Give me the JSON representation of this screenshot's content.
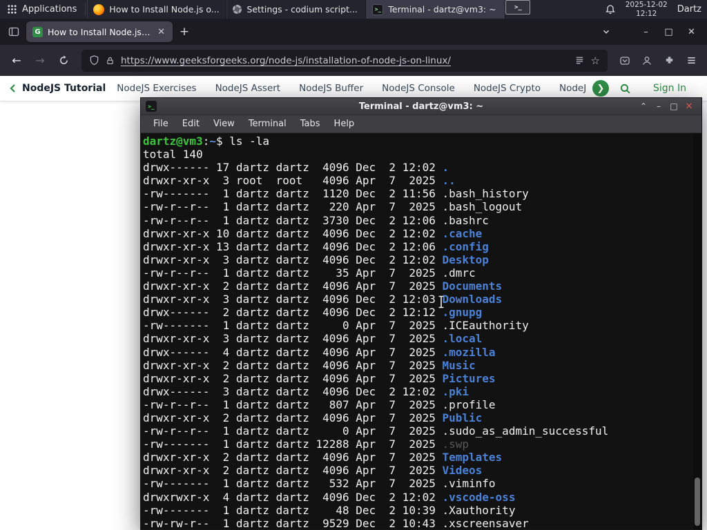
{
  "colors": {
    "gfg_green": "#2f8d46",
    "terminal_dir_blue": "#4b82d8",
    "terminal_prompt_green": "#3cc53c",
    "terminal_dim_gray": "#585858",
    "terminal_bg": "#121212",
    "browser_dark": "#2b2a33"
  },
  "taskbar": {
    "applications_label": "Applications",
    "windows": [
      {
        "icon": "firefox",
        "title": "How to Install Node.js o..."
      },
      {
        "icon": "settings",
        "title": "Settings - codium script..."
      },
      {
        "icon": "terminal",
        "title": "Terminal - dartz@vm3: ~"
      }
    ],
    "clock": {
      "date": "2025-12-02",
      "time": "12:12"
    },
    "user": "Dartz"
  },
  "browser": {
    "tab_title": "How to Install Node.js on...",
    "url": "https://www.geeksforgeeks.org/node-js/installation-of-node-js-on-linux/"
  },
  "gfg_nav": {
    "active_item": "NodeJS Tutorial",
    "items": [
      "NodeJS Exercises",
      "NodeJS Assert",
      "NodeJS Buffer",
      "NodeJS Console",
      "NodeJS Crypto",
      "NodeJS DNS",
      "Node"
    ],
    "sign_in_label": "Sign In"
  },
  "terminal": {
    "window_title": "Terminal - dartz@vm3: ~",
    "menu_items": [
      "File",
      "Edit",
      "View",
      "Terminal",
      "Tabs",
      "Help"
    ],
    "prompt_user": "dartz@vm3",
    "prompt_path": "~",
    "command": "ls -la",
    "total_line": "total 140",
    "listing": [
      {
        "perms": "drwx------",
        "links": "17",
        "owner": "dartz",
        "group": "dartz",
        "size": "4096",
        "month": "Dec",
        "day": "2",
        "time": "12:02",
        "name": ".",
        "type": "dir"
      },
      {
        "perms": "drwxr-xr-x",
        "links": "3",
        "owner": "root",
        "group": "root",
        "size": "4096",
        "month": "Apr",
        "day": "7",
        "time": "2025",
        "name": "..",
        "type": "dir"
      },
      {
        "perms": "-rw-------",
        "links": "1",
        "owner": "dartz",
        "group": "dartz",
        "size": "1120",
        "month": "Dec",
        "day": "2",
        "time": "11:56",
        "name": ".bash_history",
        "type": "file"
      },
      {
        "perms": "-rw-r--r--",
        "links": "1",
        "owner": "dartz",
        "group": "dartz",
        "size": "220",
        "month": "Apr",
        "day": "7",
        "time": "2025",
        "name": ".bash_logout",
        "type": "file"
      },
      {
        "perms": "-rw-r--r--",
        "links": "1",
        "owner": "dartz",
        "group": "dartz",
        "size": "3730",
        "month": "Dec",
        "day": "2",
        "time": "12:06",
        "name": ".bashrc",
        "type": "file"
      },
      {
        "perms": "drwxr-xr-x",
        "links": "10",
        "owner": "dartz",
        "group": "dartz",
        "size": "4096",
        "month": "Dec",
        "day": "2",
        "time": "12:02",
        "name": ".cache",
        "type": "dir"
      },
      {
        "perms": "drwxr-xr-x",
        "links": "13",
        "owner": "dartz",
        "group": "dartz",
        "size": "4096",
        "month": "Dec",
        "day": "2",
        "time": "12:06",
        "name": ".config",
        "type": "dir"
      },
      {
        "perms": "drwxr-xr-x",
        "links": "3",
        "owner": "dartz",
        "group": "dartz",
        "size": "4096",
        "month": "Dec",
        "day": "2",
        "time": "12:02",
        "name": "Desktop",
        "type": "dir"
      },
      {
        "perms": "-rw-r--r--",
        "links": "1",
        "owner": "dartz",
        "group": "dartz",
        "size": "35",
        "month": "Apr",
        "day": "7",
        "time": "2025",
        "name": ".dmrc",
        "type": "file"
      },
      {
        "perms": "drwxr-xr-x",
        "links": "2",
        "owner": "dartz",
        "group": "dartz",
        "size": "4096",
        "month": "Apr",
        "day": "7",
        "time": "2025",
        "name": "Documents",
        "type": "dir"
      },
      {
        "perms": "drwxr-xr-x",
        "links": "3",
        "owner": "dartz",
        "group": "dartz",
        "size": "4096",
        "month": "Dec",
        "day": "2",
        "time": "12:03",
        "name": "Downloads",
        "type": "dir"
      },
      {
        "perms": "drwx------",
        "links": "2",
        "owner": "dartz",
        "group": "dartz",
        "size": "4096",
        "month": "Dec",
        "day": "2",
        "time": "12:12",
        "name": ".gnupg",
        "type": "dir"
      },
      {
        "perms": "-rw-------",
        "links": "1",
        "owner": "dartz",
        "group": "dartz",
        "size": "0",
        "month": "Apr",
        "day": "7",
        "time": "2025",
        "name": ".ICEauthority",
        "type": "file"
      },
      {
        "perms": "drwxr-xr-x",
        "links": "3",
        "owner": "dartz",
        "group": "dartz",
        "size": "4096",
        "month": "Apr",
        "day": "7",
        "time": "2025",
        "name": ".local",
        "type": "dir"
      },
      {
        "perms": "drwx------",
        "links": "4",
        "owner": "dartz",
        "group": "dartz",
        "size": "4096",
        "month": "Apr",
        "day": "7",
        "time": "2025",
        "name": ".mozilla",
        "type": "dir"
      },
      {
        "perms": "drwxr-xr-x",
        "links": "2",
        "owner": "dartz",
        "group": "dartz",
        "size": "4096",
        "month": "Apr",
        "day": "7",
        "time": "2025",
        "name": "Music",
        "type": "dir"
      },
      {
        "perms": "drwxr-xr-x",
        "links": "2",
        "owner": "dartz",
        "group": "dartz",
        "size": "4096",
        "month": "Apr",
        "day": "7",
        "time": "2025",
        "name": "Pictures",
        "type": "dir"
      },
      {
        "perms": "drwx------",
        "links": "3",
        "owner": "dartz",
        "group": "dartz",
        "size": "4096",
        "month": "Dec",
        "day": "2",
        "time": "12:02",
        "name": ".pki",
        "type": "dir"
      },
      {
        "perms": "-rw-r--r--",
        "links": "1",
        "owner": "dartz",
        "group": "dartz",
        "size": "807",
        "month": "Apr",
        "day": "7",
        "time": "2025",
        "name": ".profile",
        "type": "file"
      },
      {
        "perms": "drwxr-xr-x",
        "links": "2",
        "owner": "dartz",
        "group": "dartz",
        "size": "4096",
        "month": "Apr",
        "day": "7",
        "time": "2025",
        "name": "Public",
        "type": "dir"
      },
      {
        "perms": "-rw-r--r--",
        "links": "1",
        "owner": "dartz",
        "group": "dartz",
        "size": "0",
        "month": "Apr",
        "day": "7",
        "time": "2025",
        "name": ".sudo_as_admin_successful",
        "type": "file"
      },
      {
        "perms": "-rw-------",
        "links": "1",
        "owner": "dartz",
        "group": "dartz",
        "size": "12288",
        "month": "Apr",
        "day": "7",
        "time": "2025",
        "name": ".swp",
        "type": "dim"
      },
      {
        "perms": "drwxr-xr-x",
        "links": "2",
        "owner": "dartz",
        "group": "dartz",
        "size": "4096",
        "month": "Apr",
        "day": "7",
        "time": "2025",
        "name": "Templates",
        "type": "dir"
      },
      {
        "perms": "drwxr-xr-x",
        "links": "2",
        "owner": "dartz",
        "group": "dartz",
        "size": "4096",
        "month": "Apr",
        "day": "7",
        "time": "2025",
        "name": "Videos",
        "type": "dir"
      },
      {
        "perms": "-rw-------",
        "links": "1",
        "owner": "dartz",
        "group": "dartz",
        "size": "532",
        "month": "Apr",
        "day": "7",
        "time": "2025",
        "name": ".viminfo",
        "type": "file"
      },
      {
        "perms": "drwxrwxr-x",
        "links": "4",
        "owner": "dartz",
        "group": "dartz",
        "size": "4096",
        "month": "Dec",
        "day": "2",
        "time": "12:02",
        "name": ".vscode-oss",
        "type": "dir"
      },
      {
        "perms": "-rw-------",
        "links": "1",
        "owner": "dartz",
        "group": "dartz",
        "size": "48",
        "month": "Dec",
        "day": "2",
        "time": "10:39",
        "name": ".Xauthority",
        "type": "file"
      },
      {
        "perms": "-rw-rw-r--",
        "links": "1",
        "owner": "dartz",
        "group": "dartz",
        "size": "9529",
        "month": "Dec",
        "day": "2",
        "time": "10:43",
        "name": ".xscreensaver",
        "type": "file"
      }
    ]
  }
}
